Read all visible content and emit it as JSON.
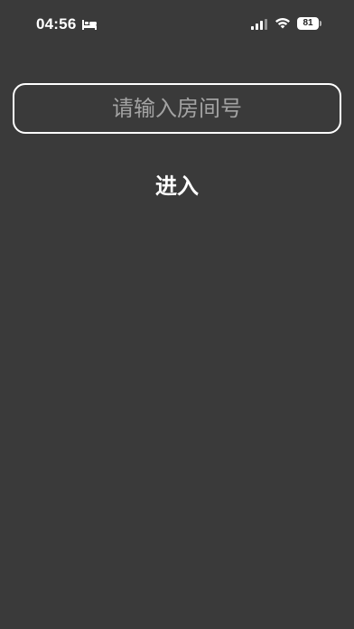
{
  "status_bar": {
    "time": "04:56",
    "battery_level": "81",
    "left_icon": "bed-icon",
    "right_icons": [
      "cellular-signal-icon",
      "wifi-icon",
      "battery-icon"
    ],
    "text_color": "#ffffff"
  },
  "form": {
    "room_input": {
      "value": "",
      "placeholder": "请输入房间号"
    },
    "enter_label": "进入"
  },
  "theme": {
    "background": "#3a3a3a",
    "input_border": "#ffffff",
    "placeholder_color": "#a3a3a3"
  }
}
